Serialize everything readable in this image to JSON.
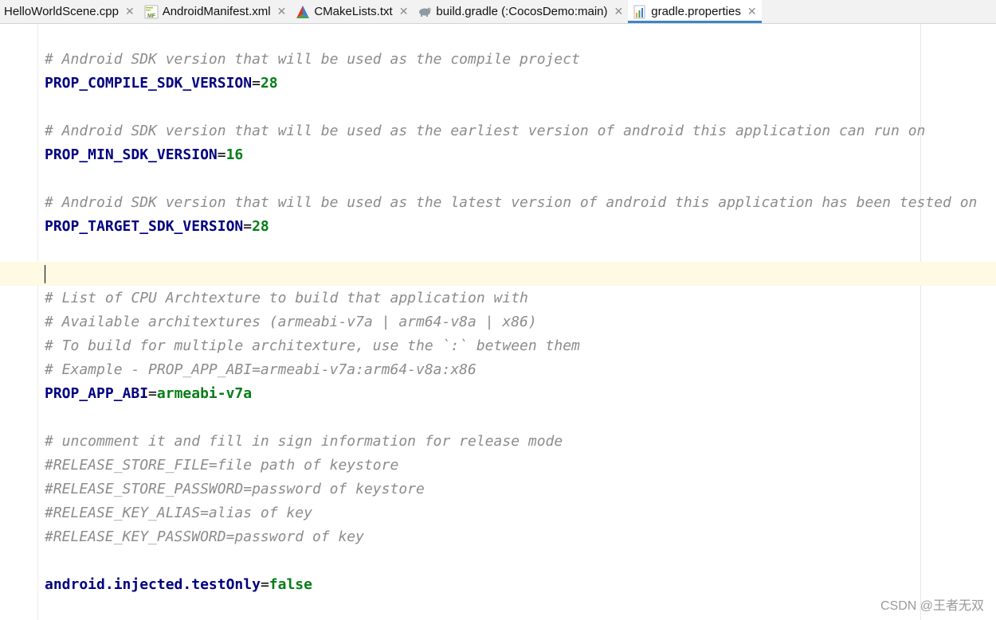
{
  "tabs": [
    {
      "label": "HelloWorldScene.cpp",
      "icon": "none",
      "active": false
    },
    {
      "label": "AndroidManifest.xml",
      "icon": "manifest-file-icon",
      "active": false
    },
    {
      "label": "CMakeLists.txt",
      "icon": "cmake-file-icon",
      "active": false
    },
    {
      "label": "build.gradle (:CocosDemo:main)",
      "icon": "gradle-elephant-icon",
      "active": false
    },
    {
      "label": "gradle.properties",
      "icon": "properties-file-icon",
      "active": true
    }
  ],
  "close_glyph": "✕",
  "manifest_icon_text": "MF",
  "code_lines": [
    {
      "type": "comment",
      "text": "# Android SDK version that will be used as the compile project"
    },
    {
      "type": "property",
      "key": "PROP_COMPILE_SDK_VERSION",
      "eq": "=",
      "value": "28"
    },
    {
      "type": "blank"
    },
    {
      "type": "comment",
      "text": "# Android SDK version that will be used as the earliest version of android this application can run on"
    },
    {
      "type": "property",
      "key": "PROP_MIN_SDK_VERSION",
      "eq": "=",
      "value": "16"
    },
    {
      "type": "blank"
    },
    {
      "type": "comment",
      "text": "# Android SDK version that will be used as the latest version of android this application has been tested on"
    },
    {
      "type": "property",
      "key": "PROP_TARGET_SDK_VERSION",
      "eq": "=",
      "value": "28"
    },
    {
      "type": "blank"
    },
    {
      "type": "blank"
    },
    {
      "type": "comment",
      "text": "# List of CPU Archtexture to build that application with"
    },
    {
      "type": "comment",
      "text": "# Available architextures (armeabi-v7a | arm64-v8a | x86)"
    },
    {
      "type": "comment",
      "text": "# To build for multiple architexture, use the `:` between them"
    },
    {
      "type": "comment",
      "text": "# Example - PROP_APP_ABI=armeabi-v7a:arm64-v8a:x86"
    },
    {
      "type": "property",
      "key": "PROP_APP_ABI",
      "eq": "=",
      "value": "armeabi-v7a"
    },
    {
      "type": "blank"
    },
    {
      "type": "comment",
      "text": "# uncomment it and fill in sign information for release mode"
    },
    {
      "type": "comment",
      "text": "#RELEASE_STORE_FILE=file path of keystore"
    },
    {
      "type": "comment",
      "text": "#RELEASE_STORE_PASSWORD=password of keystore"
    },
    {
      "type": "comment",
      "text": "#RELEASE_KEY_ALIAS=alias of key"
    },
    {
      "type": "comment",
      "text": "#RELEASE_KEY_PASSWORD=password of key"
    },
    {
      "type": "blank"
    },
    {
      "type": "property",
      "key": "android.injected.testOnly",
      "eq": "=",
      "value": "false"
    }
  ],
  "watermark": "CSDN @王者无双",
  "colors": {
    "comment": "#8c8c8c",
    "key": "#000080",
    "value": "#067d17",
    "caret_row": "#fefae3",
    "active_tab_underline": "#4083c9"
  }
}
